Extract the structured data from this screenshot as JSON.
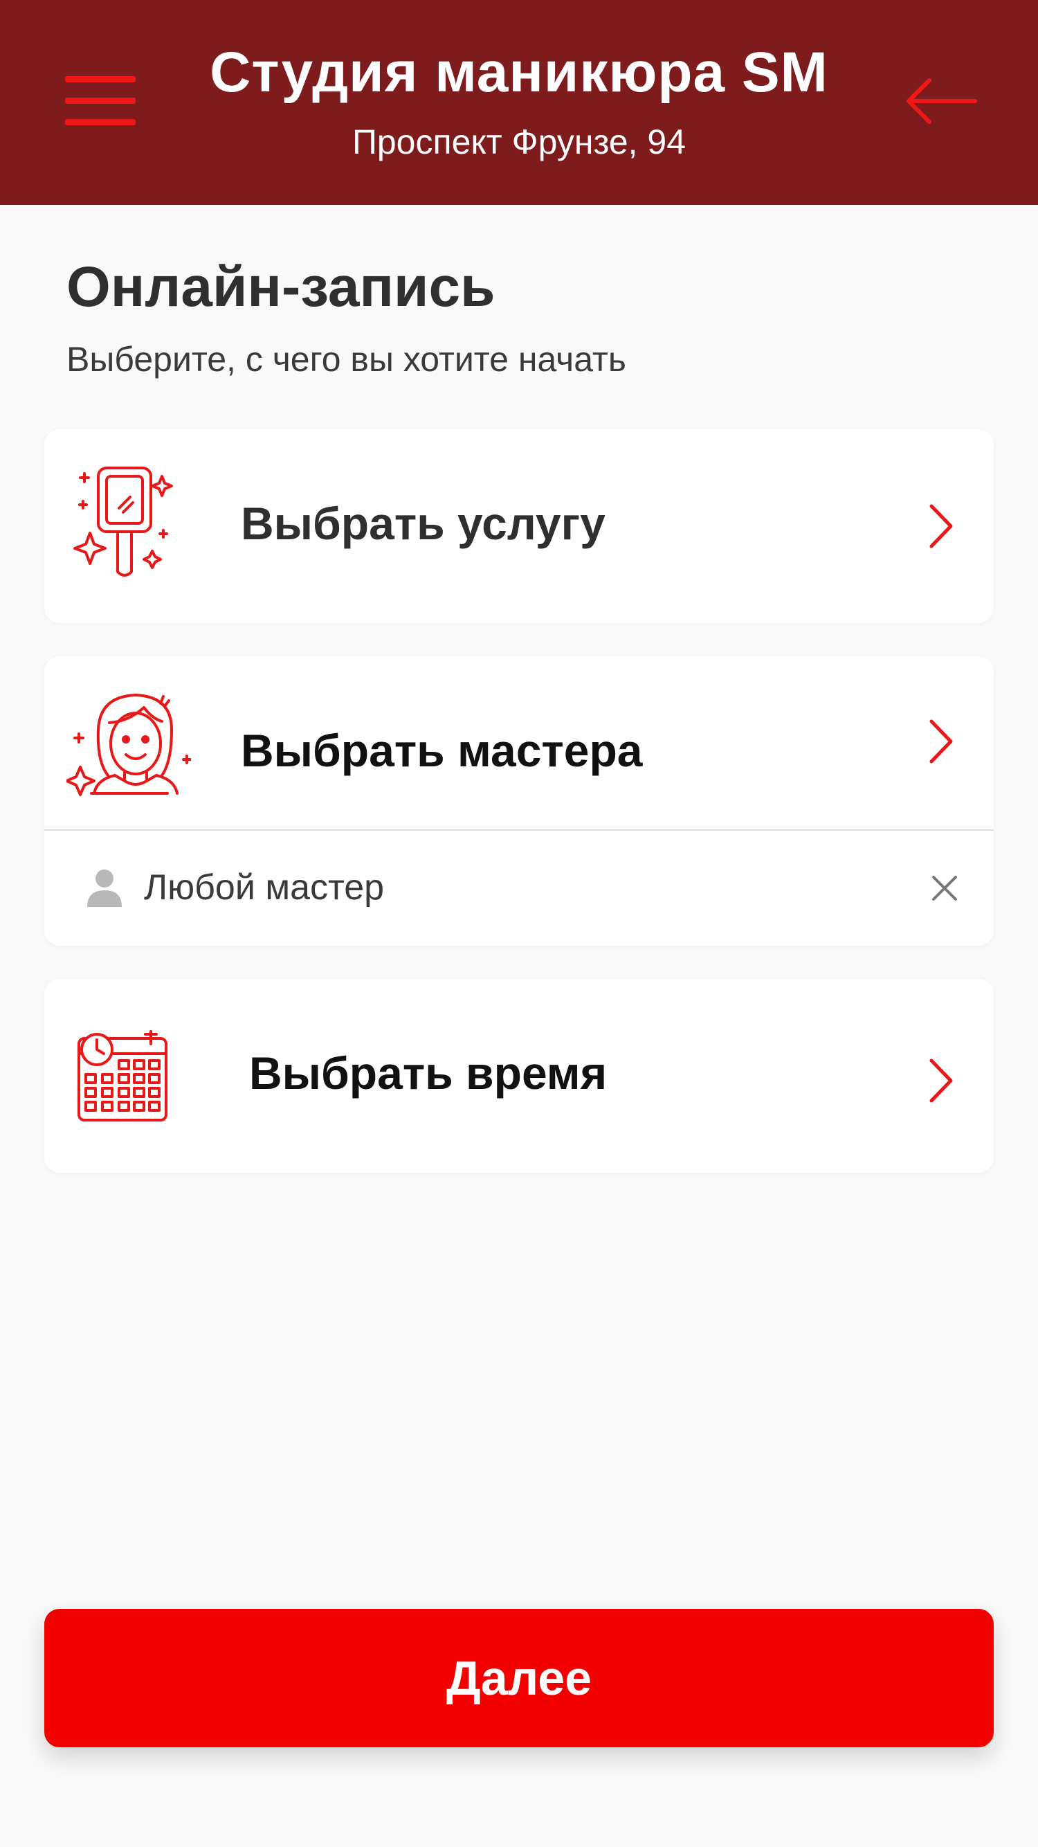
{
  "header": {
    "title": "Студия маникюра SM",
    "address": "Проспект Фрунзе, 94",
    "menu_icon": "hamburger-menu-icon",
    "back_icon": "arrow-left-icon"
  },
  "page": {
    "title": "Онлайн-запись",
    "subtitle": "Выберите, с чего вы хотите начать"
  },
  "options": {
    "service": {
      "label": "Выбрать услугу",
      "icon": "hand-mirror-icon"
    },
    "master": {
      "label": "Выбрать мастера",
      "icon": "woman-icon",
      "selected": "Любой мастер",
      "selected_icon": "person-icon",
      "clear_icon": "close-icon"
    },
    "time": {
      "label": "Выбрать время",
      "icon": "calendar-icon"
    }
  },
  "next_button": {
    "label": "Далее"
  },
  "colors": {
    "header_bg": "#7e1b1c",
    "accent": "#e81818",
    "button": "#f20000",
    "page_bg": "#f9f9f9"
  }
}
